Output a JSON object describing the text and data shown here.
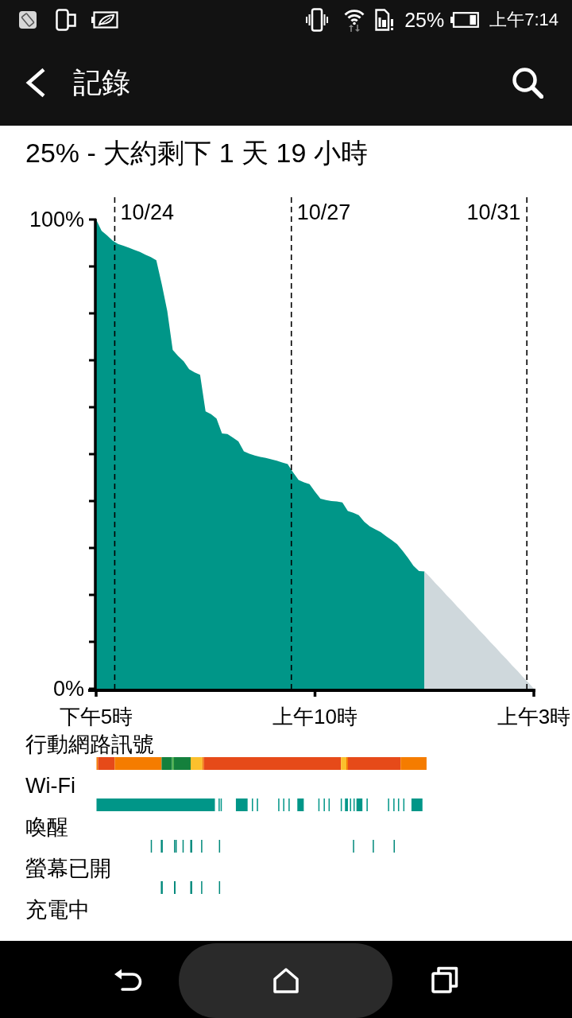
{
  "status_bar": {
    "battery_percent": "25%",
    "time": "上午7:14"
  },
  "app_bar": {
    "title": "記錄"
  },
  "summary": "25% - 大約剩下 1 天 19 小時",
  "battery_chart": {
    "chart_data": {
      "type": "area",
      "categories": [
        "下午5時",
        null,
        null,
        null,
        null,
        null,
        null,
        null,
        null,
        null,
        null,
        null,
        null,
        null,
        null,
        null,
        null,
        null,
        null,
        null,
        null,
        null,
        null,
        null,
        null,
        null,
        null,
        null,
        null,
        null,
        null,
        null,
        null,
        null,
        null,
        null,
        null,
        null,
        null,
        null,
        "上午10時",
        null,
        null,
        null,
        null,
        null,
        null,
        null,
        null,
        null,
        null,
        null,
        null,
        null,
        null,
        null,
        null,
        null,
        null,
        null,
        null,
        null,
        null,
        null,
        null,
        null,
        null,
        null,
        null,
        null,
        null,
        null,
        null,
        null,
        null,
        null,
        null,
        null,
        null,
        null,
        "上午3時"
      ],
      "series": [
        {
          "color": "#009688",
          "values": [
            100,
            97.6,
            96.6,
            95.5,
            94.8,
            94.4,
            94.0,
            93.5,
            93.1,
            92.5,
            92.0,
            91.3,
            86.2,
            80.5,
            72.2,
            70.9,
            69.8,
            68.1,
            67.4,
            66.9,
            59.1,
            58.5,
            57.6,
            54.4,
            54.3,
            53.5,
            52.7,
            50.6,
            50.1,
            49.7,
            49.4,
            49.2,
            48.9,
            48.6,
            48.2,
            47.9,
            46.1,
            44.5,
            44.0,
            43.6,
            42.0,
            40.5,
            40.2,
            40.0,
            39.9,
            39.7,
            37.9,
            37.5,
            37.0,
            35.6,
            34.6,
            34.0,
            33.4,
            32.5,
            31.7,
            30.8,
            29.4,
            27.9,
            26.2,
            25.1,
            25,
            null,
            null,
            null,
            null,
            null,
            null,
            null,
            null,
            null,
            null,
            null,
            null,
            null,
            null,
            null,
            null,
            null,
            null,
            null,
            null
          ]
        },
        {
          "color": "#cfd8dc",
          "values": [
            null,
            null,
            null,
            null,
            null,
            null,
            null,
            null,
            null,
            null,
            null,
            null,
            null,
            null,
            null,
            null,
            null,
            null,
            null,
            null,
            null,
            null,
            null,
            null,
            null,
            null,
            null,
            null,
            null,
            null,
            null,
            null,
            null,
            null,
            null,
            null,
            null,
            null,
            null,
            null,
            null,
            null,
            null,
            null,
            null,
            null,
            null,
            null,
            null,
            null,
            null,
            null,
            null,
            null,
            null,
            null,
            null,
            null,
            null,
            null,
            25,
            23.8,
            22.5,
            21.3,
            20,
            18.8,
            17.5,
            16.3,
            15,
            13.8,
            12.5,
            11.3,
            10,
            8.8,
            7.5,
            6.3,
            5,
            3.8,
            2.5,
            1.3,
            0
          ]
        }
      ],
      "ylim": [
        0,
        100
      ],
      "yticks": [
        {
          "value": 0,
          "label": "0%"
        },
        {
          "value": 100,
          "label": "100%"
        }
      ],
      "annotations": [
        "10/24",
        "10/27",
        "10/31"
      ]
    }
  },
  "timelines": [
    {
      "kind": "signal",
      "label": "行動網路訊號"
    },
    {
      "kind": "wifi",
      "label": "Wi-Fi"
    },
    {
      "kind": "awake",
      "label": "喚醒"
    },
    {
      "kind": "screen",
      "label": "螢幕已開"
    },
    {
      "kind": "charging",
      "label": "充電中"
    }
  ]
}
